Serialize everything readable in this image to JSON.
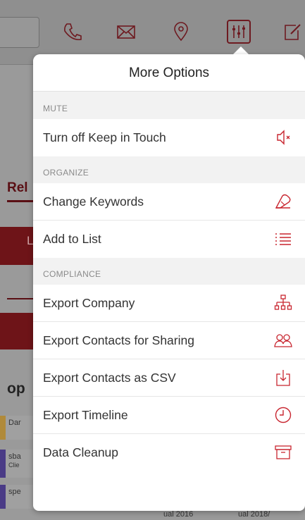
{
  "colors": {
    "accent": "#c8252f",
    "section_bg": "#f2f2f2",
    "text": "#333333"
  },
  "background": {
    "toolbar_icons": [
      "phone-icon",
      "mail-icon",
      "location-pin-icon",
      "settings-sliders-icon",
      "edit-icon"
    ],
    "rel_label": "Rel",
    "red_button_1": "Le",
    "section_label": "op",
    "chips": [
      "Dar",
      "sba",
      "Clie",
      "spe"
    ],
    "footer_1": "ual 2016",
    "footer_2": "ual 2018/"
  },
  "popover": {
    "title": "More Options",
    "sections": [
      {
        "header": "MUTE",
        "items": [
          {
            "label": "Turn off Keep in Touch",
            "icon": "speaker-mute-icon"
          }
        ]
      },
      {
        "header": "ORGANIZE",
        "items": [
          {
            "label": "Change Keywords",
            "icon": "tag-icon"
          },
          {
            "label": "Add to List",
            "icon": "list-icon"
          }
        ]
      },
      {
        "header": "COMPLIANCE",
        "items": [
          {
            "label": "Export Company",
            "icon": "org-chart-icon"
          },
          {
            "label": "Export Contacts for Sharing",
            "icon": "contacts-group-icon"
          },
          {
            "label": "Export Contacts as CSV",
            "icon": "download-icon"
          },
          {
            "label": "Export Timeline",
            "icon": "clock-icon"
          },
          {
            "label": "Data Cleanup",
            "icon": "archive-box-icon"
          }
        ]
      }
    ]
  }
}
